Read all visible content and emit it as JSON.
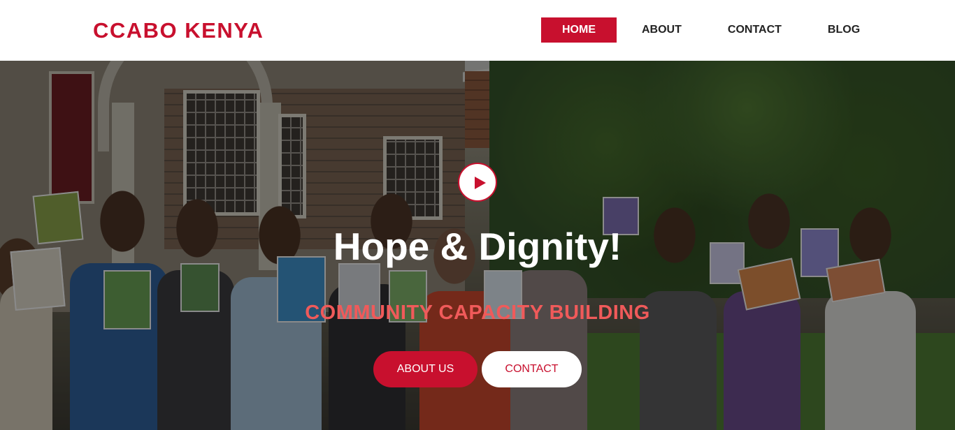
{
  "brand": {
    "name": "CCABO KENYA"
  },
  "nav": {
    "items": [
      {
        "label": "HOME",
        "active": true
      },
      {
        "label": "ABOUT",
        "active": false
      },
      {
        "label": "CONTACT",
        "active": false
      },
      {
        "label": "BLOG",
        "active": false
      }
    ]
  },
  "hero": {
    "play_icon": "play-icon",
    "headline": "Hope & Dignity!",
    "subheadline": "COMMUNITY CAPACITY BUILDING",
    "buttons": [
      {
        "label": "ABOUT US"
      },
      {
        "label": "CONTACT"
      }
    ]
  },
  "colors": {
    "accent": "#c8102e",
    "subheadline": "#f05a5a",
    "nav_text": "#222222",
    "background": "#ffffff"
  }
}
